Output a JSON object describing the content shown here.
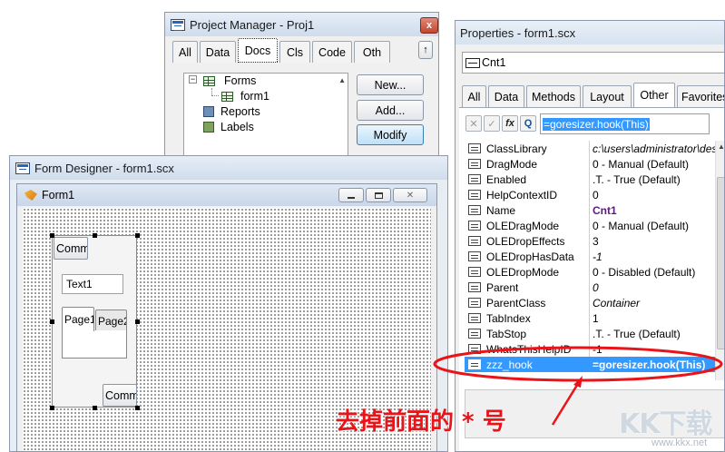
{
  "project_manager": {
    "title": "Project Manager - Proj1",
    "close": "x",
    "tabs": [
      "All",
      "Data",
      "Docs",
      "Cls",
      "Code",
      "Oth"
    ],
    "collapse": "↑",
    "tree": {
      "expander": "−",
      "forms": "Forms",
      "form1": "form1",
      "reports": "Reports",
      "labels": "Labels"
    },
    "buttons": {
      "new": "New...",
      "add": "Add...",
      "modify": "Modify"
    }
  },
  "form_designer": {
    "title": "Form Designer - form1.scx",
    "form_title": "Form1",
    "controls": {
      "command_top": "Comm",
      "text1": "Text1",
      "page1": "Page1",
      "page2": "Page2",
      "command_bottom": "Comm"
    }
  },
  "properties": {
    "title": "Properties - form1.scx",
    "object": "Cnt1",
    "tabs": [
      "All",
      "Data",
      "Methods",
      "Layout",
      "Other",
      "Favorites"
    ],
    "toolbar": {
      "cancel": "✕",
      "confirm": "✓",
      "fx": "fx",
      "zoom": "Q"
    },
    "edit_value": "=goresizer.hook(This)",
    "rows": [
      {
        "name": "ClassLibrary",
        "value": "c:\\users\\administrator\\des",
        "style": "italic"
      },
      {
        "name": "DragMode",
        "value": "0 - Manual (Default)",
        "style": ""
      },
      {
        "name": "Enabled",
        "value": ".T. - True (Default)",
        "style": ""
      },
      {
        "name": "HelpContextID",
        "value": "0",
        "style": ""
      },
      {
        "name": "Name",
        "value": "Cnt1",
        "style": "bold"
      },
      {
        "name": "OLEDragMode",
        "value": "0 - Manual (Default)",
        "style": ""
      },
      {
        "name": "OLEDropEffects",
        "value": "3",
        "style": ""
      },
      {
        "name": "OLEDropHasData",
        "value": "-1",
        "style": "italic"
      },
      {
        "name": "OLEDropMode",
        "value": "0 - Disabled (Default)",
        "style": ""
      },
      {
        "name": "Parent",
        "value": "0",
        "style": "italic"
      },
      {
        "name": "ParentClass",
        "value": "Container",
        "style": "italic"
      },
      {
        "name": "TabIndex",
        "value": "1",
        "style": ""
      },
      {
        "name": "TabStop",
        "value": ".T. - True (Default)",
        "style": ""
      },
      {
        "name": "WhatsThisHelpID",
        "value": "-1",
        "style": ""
      },
      {
        "name": "zzz_hook",
        "value": "=goresizer.hook(This)",
        "style": "highlight"
      }
    ]
  },
  "annotation": {
    "text": "去掉前面的 * 号",
    "color": "#e8141a"
  },
  "watermark": {
    "brand": "KK下载",
    "url": "www.kkx.net"
  }
}
